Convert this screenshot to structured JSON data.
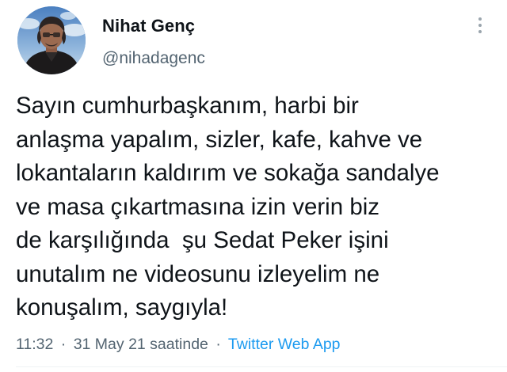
{
  "author": {
    "display_name": "Nihat Genç",
    "username": "@nihadagenc",
    "avatar_icon": "profile-photo-icon"
  },
  "tweet": {
    "lines": [
      "Sayın cumhurbaşkanım, harbi bir",
      "anlaşma yapalım, sizler, kafe, kahve ve",
      "lokantaların kaldırım ve sokağa sandalye",
      "ve masa çıkartmasına izin verin biz",
      "de karşılığında  şu Sedat Peker işini",
      "unutalım ne videosunu izleyelim ne",
      "konuşalım, saygıyla!"
    ]
  },
  "meta": {
    "time": "11:32",
    "date": "31 May 21 saatinde",
    "separator": "·",
    "source": "Twitter Web App"
  },
  "icons": {
    "more": "more-vertical-icon"
  },
  "colors": {
    "text_primary": "#0f1419",
    "text_secondary": "#536471",
    "link": "#1d9bf0"
  }
}
